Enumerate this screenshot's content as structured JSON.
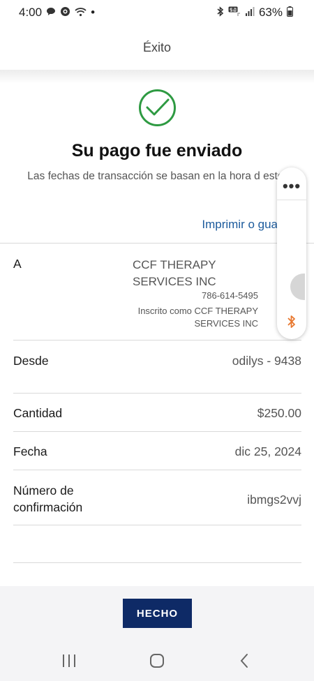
{
  "status_bar": {
    "time": "4:00",
    "dot": "•",
    "battery": "63%",
    "icons": [
      "chat-bubble-icon",
      "media-icon",
      "wifi-icon",
      "bluetooth-icon",
      "5g-icon",
      "signal-icon",
      "battery-icon"
    ]
  },
  "header": {
    "title": "Éxito"
  },
  "success": {
    "title": "Su pago fue enviado",
    "subtitle": "Las fechas de transacción se basan en la hora d este.",
    "print_link": "Imprimir o gua"
  },
  "details": {
    "to": {
      "label": "A",
      "name": "CCF THERAPY SERVICES INC",
      "phone": "786-614-5495",
      "enrolled": "Inscrito como CCF THERAPY SERVICES INC"
    },
    "from": {
      "label": "Desde",
      "value": "odilys - 9438"
    },
    "amount": {
      "label": "Cantidad",
      "value": "$250.00"
    },
    "date": {
      "label": "Fecha",
      "value": "dic 25, 2024"
    },
    "confirmation": {
      "label": "Número de confirmación",
      "value": "ibmgs2vvj"
    }
  },
  "floating_panel": {
    "menu": "•••",
    "icons": [
      "more-icon",
      "bluetooth-icon"
    ]
  },
  "actions": {
    "done_label": "HECHO"
  },
  "colors": {
    "accent_blue": "#1b5a9c",
    "button_navy": "#0e2a66",
    "success_green": "#2e9a42",
    "bt_orange": "#e8772e"
  }
}
